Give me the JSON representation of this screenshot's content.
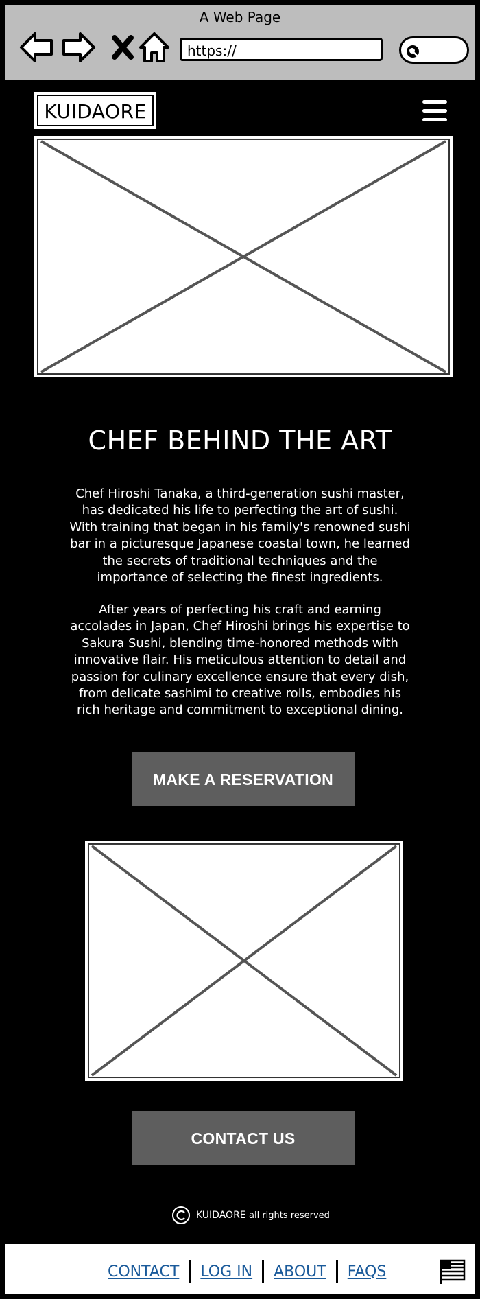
{
  "browser": {
    "title": "A Web Page",
    "url": "https://",
    "icons": [
      "back-arrow-icon",
      "forward-arrow-icon",
      "close-x-icon",
      "home-icon",
      "search-icon"
    ]
  },
  "header": {
    "logo": "KUIDAORE",
    "menu_icon": "hamburger-menu-icon"
  },
  "main": {
    "heading": "CHEF BEHIND THE ART",
    "paragraph1": "Chef Hiroshi Tanaka, a third-generation sushi master, has dedicated his life to perfecting the art of sushi. With training that began in his family's renowned sushi bar in a picturesque Japanese coastal town, he learned the secrets of traditional techniques and the importance of selecting the finest ingredients.",
    "paragraph2": "After years of perfecting his craft and earning accolades in Japan, Chef Hiroshi brings his expertise to Sakura Sushi, blending time-honored methods with innovative flair. His meticulous attention to detail and passion for culinary excellence ensure that every dish, from delicate sashimi to creative rolls, embodies his rich heritage and commitment to exceptional dining.",
    "reservation_button": "MAKE A RESERVATION",
    "contact_button": "CONTACT US"
  },
  "copyright": {
    "icon": "copyright-icon",
    "brand": "KUIDAORE",
    "text": "all rights reserved"
  },
  "footer": {
    "links": [
      "CONTACT",
      "LOG IN",
      "ABOUT",
      "FAQS"
    ],
    "flag_icon": "us-flag-icon"
  },
  "colors": {
    "background": "#000000",
    "chrome": "#bdbdbd",
    "button": "#5e5e5e",
    "link": "#1a5a9a",
    "placeholder_line": "#555555"
  }
}
